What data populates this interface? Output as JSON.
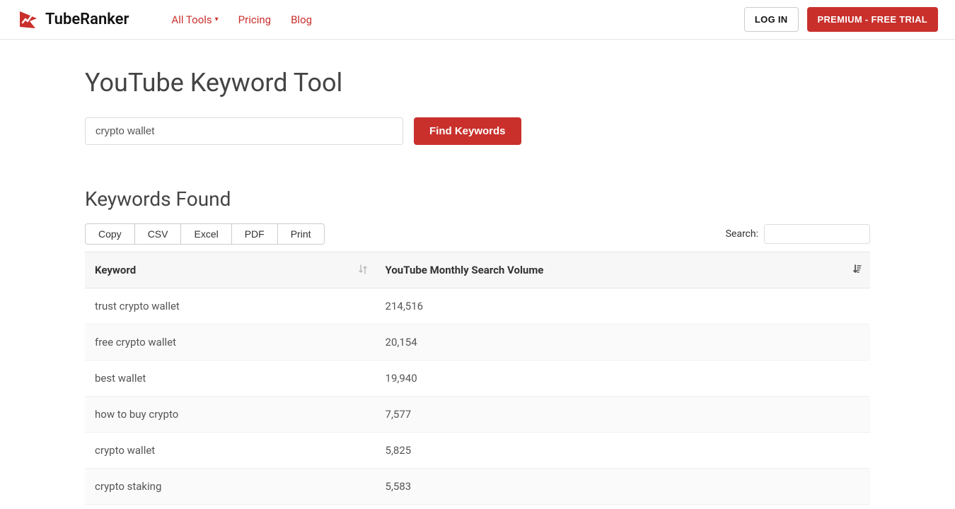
{
  "brand": "TubeRanker",
  "nav": {
    "all_tools": "All Tools",
    "pricing": "Pricing",
    "blog": "Blog"
  },
  "header_right": {
    "login": "LOG IN",
    "premium": "PREMIUM - FREE TRIAL"
  },
  "page_title": "YouTube Keyword Tool",
  "search": {
    "value": "crypto wallet",
    "find_button": "Find Keywords"
  },
  "results": {
    "heading": "Keywords Found",
    "export": [
      "Copy",
      "CSV",
      "Excel",
      "PDF",
      "Print"
    ],
    "filter_label": "Search:",
    "filter_value": "",
    "columns": {
      "keyword": "Keyword",
      "volume": "YouTube Monthly Search Volume"
    },
    "rows": [
      {
        "keyword": "trust crypto wallet",
        "volume": "214,516"
      },
      {
        "keyword": "free crypto wallet",
        "volume": "20,154"
      },
      {
        "keyword": "best wallet",
        "volume": "19,940"
      },
      {
        "keyword": "how to buy crypto",
        "volume": "7,577"
      },
      {
        "keyword": "crypto wallet",
        "volume": "5,825"
      },
      {
        "keyword": "crypto staking",
        "volume": "5,583"
      }
    ]
  }
}
